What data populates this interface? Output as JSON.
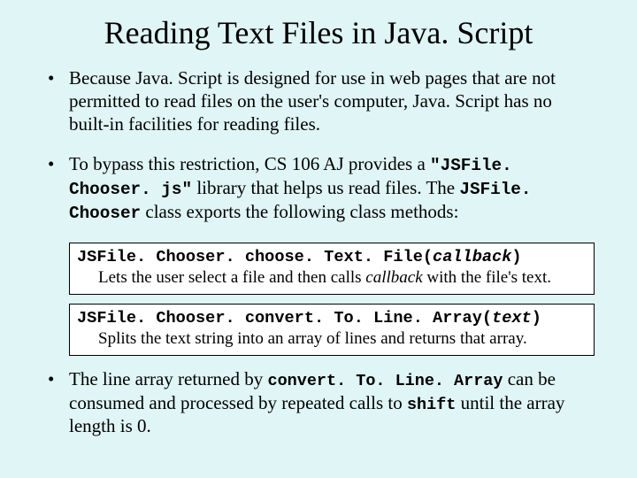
{
  "title": "Reading Text Files in Java. Script",
  "bullet1": {
    "text": "Because Java. Script is designed for use in web pages that are not permitted to read files on the user's computer, Java. Script has no built-in facilities for reading files."
  },
  "bullet2": {
    "pre": "To bypass this restriction, CS 106 AJ provides a ",
    "lib": "\"JSFile. Chooser. js\"",
    "mid": " library that helps us read files.  The ",
    "cls": "JSFile. Chooser",
    "post": " class exports the following class methods:"
  },
  "method1": {
    "sig_pre": "JSFile. Chooser. choose. Text. File(",
    "sig_arg": "callback",
    "sig_post": ")",
    "desc_pre": "Lets the user select a file and then calls ",
    "desc_arg": "callback",
    "desc_post": " with the file's text."
  },
  "method2": {
    "sig_pre": "JSFile. Chooser. convert. To. Line. Array(",
    "sig_arg": "text",
    "sig_post": ")",
    "desc": "Splits the text string into an array of lines and returns that array."
  },
  "bullet3": {
    "pre": "The line array returned by ",
    "code1": "convert. To. Line. Array",
    "mid": " can be consumed and processed by repeated calls to ",
    "code2": "shift",
    "post": " until the array length is 0."
  }
}
